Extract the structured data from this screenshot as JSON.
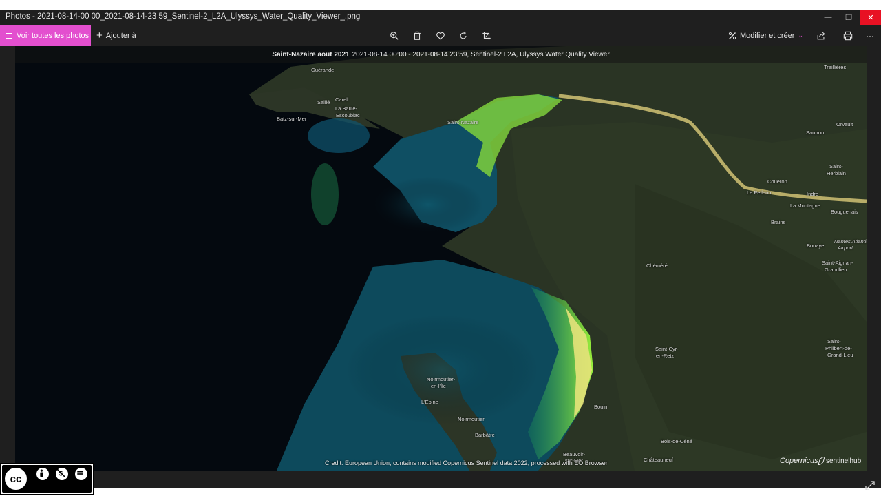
{
  "window": {
    "title": "Photos - 2021-08-14-00 00_2021-08-14-23 59_Sentinel-2_L2A_Ulyssys_Water_Quality_Viewer_.png",
    "controls": {
      "minimize": "—",
      "maximize": "❐",
      "close": "✕"
    }
  },
  "toolbar": {
    "view_all_label": "Voir toutes les photos",
    "add_to_label": "Ajouter à",
    "edit_create_label": "Modifier et créer",
    "more_label": "···",
    "accent_color": "#e34fcf",
    "icons": [
      "zoom-icon",
      "delete-icon",
      "favorite-icon",
      "rotate-icon",
      "crop-icon",
      "share-icon",
      "print-icon"
    ]
  },
  "photo": {
    "header_bold": "Saint-Nazaire aout 2021",
    "header_rest": "2021-08-14 00:00 - 2021-08-14 23:59, Sentinel-2 L2A, Ulyssys Water Quality Viewer",
    "credit": "Credit: European Union, contains modified Copernicus Sentinel data 2022, processed with EO Browser",
    "copernicus": "Copernicus",
    "sentinelhub": "sentinelhub",
    "places": {
      "guerande": "Guérande",
      "trellieres": "Treillières",
      "saille": "Saillé",
      "carell": "Carell",
      "labaule": "La Baule-",
      "escoublac": "Escoublac",
      "batz": "Batz-sur-Mer",
      "saintnazaire": "Saint-Nazaire",
      "sautron": "Sautron",
      "orvault": "Orvault",
      "saintherblain1": "Saint-",
      "saintherblain2": "Herblain",
      "coueron": "Couëron",
      "lepellerin": "Le Pellerin",
      "indre": "Indre",
      "lamontagne": "La Montagne",
      "bouguenais": "Bouguenais",
      "brains": "Brains",
      "bouaye": "Bouaye",
      "airport1": "Nantes Atlantique",
      "airport2": "Airport",
      "saintaignan1": "Saint-Aignan-",
      "saintaignan2": "Grandlieu",
      "chemere": "Chéméré",
      "saintcyr1": "Saint-Cyr-",
      "saintcyr2": "en-Retz",
      "saintphilbert1": "Saint-",
      "saintphilbert2": "Philbert-de-",
      "saintphilbert3": "Grand-Lieu",
      "noirmoutier1": "Noirmoutier-",
      "noirmoutier2": "en-l'Île",
      "lepine": "L'Épine",
      "noirmoutier": "Noirmoutier",
      "barbatre": "Barbâtre",
      "bouin": "Bouin",
      "boisdecene": "Bois-de-Céné",
      "beauvoir1": "Beauvoir-",
      "beauvoir2": "sur-Mer",
      "chateauneuf": "Châteauneuf"
    }
  },
  "license": {
    "cc": "cc",
    "by": "BY",
    "nc": "NC",
    "nd": "ND"
  }
}
